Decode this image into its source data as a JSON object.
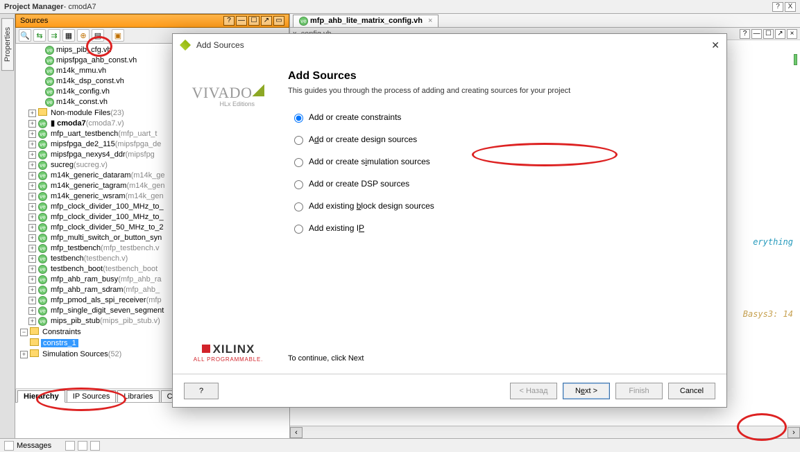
{
  "window": {
    "title_a": "Project Manager",
    "title_b": " - cmodA7",
    "help": "?",
    "close": "X"
  },
  "properties_tab": "Properties",
  "sources_panel": {
    "title": "Sources",
    "help": "?",
    "min": "—",
    "sq": "☐",
    "pop": "↗",
    "full": "▭"
  },
  "tree": {
    "files": [
      "mips_pib_cfg.vh",
      "mipsfpga_ahb_const.vh",
      "m14k_mmu.vh",
      "m14k_dsp_const.vh",
      "m14k_config.vh",
      "m14k_const.vh"
    ],
    "nonmod": "Non-module Files",
    "nonmod_cnt": "(23)",
    "cmoda7": "cmoda7",
    "cmoda7_g": "(cmoda7.v)",
    "mods": [
      {
        "n": "mfp_uart_testbench",
        "g": "(mfp_uart_t"
      },
      {
        "n": "mipsfpga_de2_115",
        "g": "(mipsfpga_de"
      },
      {
        "n": "mipsfpga_nexys4_ddr",
        "g": "(mipsfpg"
      },
      {
        "n": "sucreg",
        "g": "(sucreg.v)"
      },
      {
        "n": "m14k_generic_dataram",
        "g": "(m14k_ge"
      },
      {
        "n": "m14k_generic_tagram",
        "g": "(m14k_gen"
      },
      {
        "n": "m14k_generic_wsram",
        "g": "(m14k_gen"
      },
      {
        "n": "mfp_clock_divider_100_MHz_to_",
        "g": ""
      },
      {
        "n": "mfp_clock_divider_100_MHz_to_",
        "g": ""
      },
      {
        "n": "mfp_clock_divider_50_MHz_to_2",
        "g": ""
      },
      {
        "n": "mfp_multi_switch_or_button_syn",
        "g": ""
      },
      {
        "n": "mfp_testbench",
        "g": "(mfp_testbench.v"
      },
      {
        "n": "testbench",
        "g": "(testbench.v)"
      },
      {
        "n": "testbench_boot",
        "g": "(testbench_boot"
      },
      {
        "n": "mfp_ahb_ram_busy",
        "g": "(mfp_ahb_ra"
      },
      {
        "n": "mfp_ahb_ram_sdram",
        "g": "(mfp_ahb_"
      },
      {
        "n": "mfp_pmod_als_spi_receiver",
        "g": "(mfp"
      },
      {
        "n": "mfp_single_digit_seven_segment",
        "g": ""
      },
      {
        "n": "mips_pib_stub",
        "g": "(mips_pib_stub.v)"
      }
    ],
    "constraints": "Constraints",
    "constrs1": "constrs_1",
    "sim": "Simulation Sources",
    "sim_cnt": "(52)"
  },
  "tabs": {
    "h": "Hierarchy",
    "ip": "IP Sources",
    "lib": "Libraries",
    "co": "Compile Order"
  },
  "status": {
    "msg": "Messages"
  },
  "editor": {
    "tab": "mfp_ahb_lite_matrix_config.vh",
    "close": "×",
    "filelbl": "x_config.vh",
    "l1": "erything",
    "l2": "Basys3: 14"
  },
  "dialog": {
    "title": "Add Sources",
    "h1": "Add Sources",
    "desc": "This guides you through the process of adding and creating sources for your project",
    "opts": {
      "a": "Add or create constraints",
      "b_pre": "A",
      "b_u": "d",
      "b_post": "d or create design sources",
      "c_pre": "Add or create s",
      "c_u": "i",
      "c_post": "mulation sources",
      "d": "Add or create DSP sources",
      "e": "Add existing ",
      "e_u": "b",
      "e_post": "lock design sources",
      "f": "Add existing I",
      "f_u": "P"
    },
    "cont": "To continue, click Next",
    "vivado": "VIVADO",
    "hlx": "HLx Editions",
    "xilinx": "XILINX",
    "xsub": "ALL PROGRAMMABLE.",
    "help": "?",
    "back": "< Назад",
    "next_pre": "N",
    "next_u": "e",
    "next_post": "xt >",
    "finish": "Finish",
    "cancel": "Cancel"
  }
}
